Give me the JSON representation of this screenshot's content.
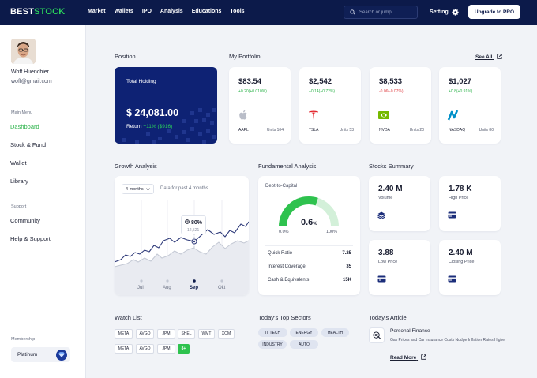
{
  "brand": {
    "part1": "BEST",
    "part2": "STOCK"
  },
  "nav": [
    "Market",
    "Wallets",
    "IPO",
    "Analysis",
    "Educations",
    "Tools"
  ],
  "search": {
    "placeholder": "Search or jump"
  },
  "setting_label": "Setting",
  "upgrade_label": "Upgrade to PRO",
  "user": {
    "name": "Woff Huencbier",
    "email": "woff@gmail.com"
  },
  "sidebar": {
    "main_menu_label": "Main Menu",
    "main_items": [
      "Dashboard",
      "Stock & Fund",
      "Wallet",
      "Library"
    ],
    "support_label": "Support",
    "support_items": [
      "Community",
      "Help & Support"
    ],
    "membership_label": "Membership",
    "plan": "Platinum"
  },
  "position": {
    "title": "Position",
    "holding_label": "Total Holding",
    "holding_value": "$ 24,081.00",
    "return_label": "Return",
    "return_value": "+11% ($916)"
  },
  "portfolio": {
    "title": "My Portfolio",
    "see_all": "See All",
    "stocks": [
      {
        "price": "$83.54",
        "change": "+0.20(+0.010%)",
        "ticker": "AAPL",
        "units": "Units 104",
        "trend": "up",
        "icon": "apple-icon"
      },
      {
        "price": "$2,542",
        "change": "+0.14(+0.72%)",
        "ticker": "TSLA",
        "units": "Units 53",
        "trend": "up",
        "icon": "tesla-icon"
      },
      {
        "price": "$8,533",
        "change": "-0.06(-0.07%)",
        "ticker": "NVDA",
        "units": "Units 20",
        "trend": "down",
        "icon": "nvidia-icon"
      },
      {
        "price": "$1,027",
        "change": "+0.8(+0.91%)",
        "ticker": "NASDAQ",
        "units": "Units 80",
        "trend": "up",
        "icon": "nasdaq-icon"
      }
    ]
  },
  "growth": {
    "title": "Growth Analysis",
    "range": "4 months",
    "range_label": "Data for past 4 months",
    "tooltip_value": "80%",
    "tooltip_sub": "12,521",
    "months": [
      "Jul",
      "Aug",
      "Sep",
      "Okt"
    ],
    "selected_month": "Sep"
  },
  "fundamental": {
    "title": "Fundamental Analysis",
    "gauge_label": "Debt-to-Capital",
    "gauge_value": "0.6",
    "gauge_unit": "%",
    "gauge_min": "0.0%",
    "gauge_max": "100%",
    "gauge_fraction": 0.6,
    "metrics": [
      {
        "label": "Quick Ratio",
        "value": "7.25"
      },
      {
        "label": "Interest Coverage",
        "value": "35"
      },
      {
        "label": "Cash & Equivalents",
        "value": "15K"
      }
    ]
  },
  "summary": {
    "title": "Stocks Summary",
    "items": [
      {
        "value": "2.40 M",
        "label": "Volume"
      },
      {
        "value": "1.78 K",
        "label": "High Price"
      },
      {
        "value": "3.88",
        "label": "Low Price"
      },
      {
        "value": "2.40 M",
        "label": "Closing Price"
      }
    ]
  },
  "watchlist": {
    "title": "Watch List",
    "row1": [
      "META",
      "AVGO",
      "JPM",
      "SHEL",
      "WMT",
      "XOM"
    ],
    "row2": [
      "META",
      "AVGO",
      "JPM"
    ],
    "add_label": "8+"
  },
  "sectors": {
    "title": "Today's Top Sectors",
    "row1": [
      "IT TECH",
      "ENERGY",
      "HEALTH"
    ],
    "row2": [
      "INDUSTRY",
      "AUTO"
    ]
  },
  "article": {
    "title": "Today's Article",
    "heading": "Personal Finance",
    "desc": "Gas Prices and Car Insurance Costs Nudge Inflation Rates Higher",
    "read_more": "Read More"
  },
  "colors": {
    "navy": "#0c1a4a",
    "green": "#2cb34a",
    "red": "#e0464a",
    "card_blue": "#0e2274"
  }
}
